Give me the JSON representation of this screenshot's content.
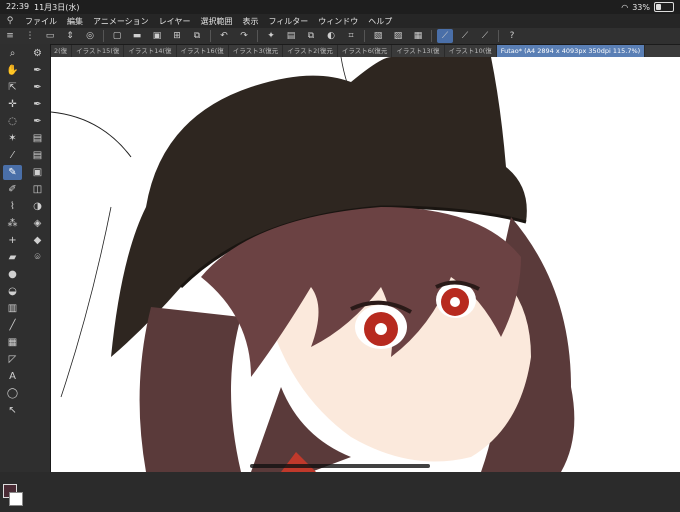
{
  "status": {
    "time": "22:39",
    "date": "11月3日(水)",
    "battery": "33%",
    "battery_level": 0.33
  },
  "menu": {
    "logo_icon": "clip-studio-logo-icon",
    "items": [
      "ファイル",
      "編集",
      "アニメーション",
      "レイヤー",
      "選択範囲",
      "表示",
      "フィルター",
      "ウィンドウ",
      "ヘルプ"
    ]
  },
  "tabs": [
    {
      "label": "2(復"
    },
    {
      "label": "イラスト15(復"
    },
    {
      "label": "イラスト14(復"
    },
    {
      "label": "イラスト16(復"
    },
    {
      "label": "イラスト3(復元"
    },
    {
      "label": "イラスト2(復元"
    },
    {
      "label": "イラスト6(復元"
    },
    {
      "label": "イラスト13(復"
    },
    {
      "label": "イラスト10(復"
    },
    {
      "label": "Futao* (A4 2894 x 4093px 350dpi 115.7%)",
      "active": true
    }
  ],
  "colors": {
    "main": "#4a2b35",
    "sub": "#ffffff",
    "accent": "#4a6fa8"
  }
}
